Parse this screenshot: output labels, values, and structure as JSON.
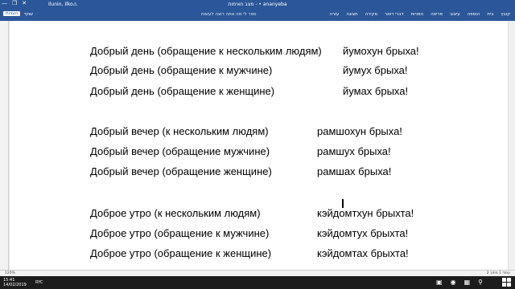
{
  "window": {
    "title": "מצב תאימות - •  ananyeba",
    "user": "Ilunin, Ilko⚠",
    "controls": [
      "—",
      "❐",
      "✕"
    ]
  },
  "ribbon": {
    "tabs": [
      "קובץ",
      "בית",
      "הוספה",
      "עיצוב",
      "פריסה",
      "הפניות",
      "דברי דואר",
      "סקירה",
      "תצוגה",
      "עזרה"
    ],
    "tell_me": "ספר לי מה אתה רוצה לעשות",
    "share_label": "שתף",
    "comments_label": "הערות"
  },
  "document": {
    "lines": [
      {
        "ru": "Добрый день (обращение к нескольким людям)",
        "tr": "йумохун брыха!"
      },
      {
        "ru": "Добрый день (обращение к мужчине)",
        "tr": "йумух брыха!"
      },
      {
        "ru": "Добрый день (обращение к женщине)",
        "tr": "йумах брыха!"
      },
      {
        "ru": "Добрый вечер (к нескольким людям)",
        "tr": "рамшохун брыха!"
      },
      {
        "ru": "Добрый вечер (обращение мужчине)",
        "tr": "рамшух брыха!"
      },
      {
        "ru": "Добрый вечер (обращение женщине)",
        "tr": "рамшах брыха!"
      },
      {
        "ru": "Доброе утро (к нескольким людям)",
        "tr": "кэйдомтхун брыхта!"
      },
      {
        "ru": "Доброе утро (обращение к мужчине)",
        "tr": "кэйдомтух брыхта!"
      },
      {
        "ru": "Доброе утро (обращение к женщине)",
        "tr": "кэйдомтах брыхта!"
      }
    ]
  },
  "statusbar": {
    "left": "120%",
    "right": "עמוד 1 מתוך 2"
  },
  "taskbar": {
    "time": "15:41",
    "date": "14/02/2019",
    "lang": "RYC"
  }
}
